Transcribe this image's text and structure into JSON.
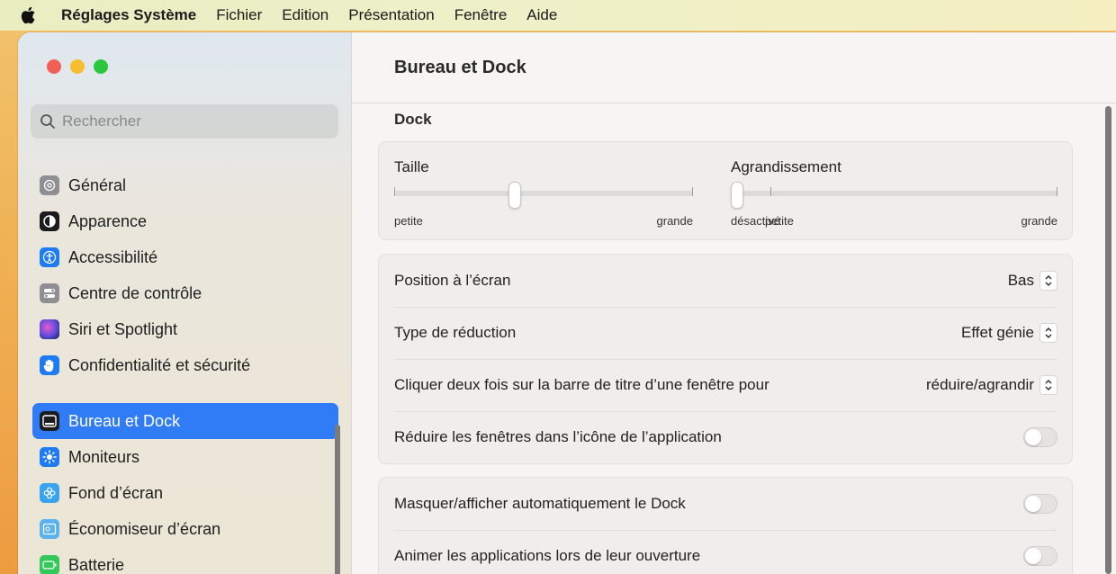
{
  "menubar": {
    "app_name": "Réglages Système",
    "items": [
      "Fichier",
      "Edition",
      "Présentation",
      "Fenêtre",
      "Aide"
    ]
  },
  "search": {
    "placeholder": "Rechercher"
  },
  "sidebar": {
    "items": [
      {
        "label": "Général",
        "icon": "gear-icon"
      },
      {
        "label": "Apparence",
        "icon": "appearance-icon"
      },
      {
        "label": "Accessibilité",
        "icon": "accessibility-icon"
      },
      {
        "label": "Centre de contrôle",
        "icon": "control-center-icon"
      },
      {
        "label": "Siri et Spotlight",
        "icon": "siri-icon"
      },
      {
        "label": "Confidentialité et sécurité",
        "icon": "privacy-hand-icon"
      },
      {
        "label": "Bureau et Dock",
        "icon": "desktop-dock-icon"
      },
      {
        "label": "Moniteurs",
        "icon": "sun-icon"
      },
      {
        "label": "Fond d’écran",
        "icon": "wallpaper-flower-icon"
      },
      {
        "label": "Économiseur d’écran",
        "icon": "screensaver-icon"
      },
      {
        "label": "Batterie",
        "icon": "battery-icon"
      }
    ],
    "selected": "Bureau et Dock"
  },
  "main": {
    "title": "Bureau et Dock",
    "section": "Dock",
    "size_slider": {
      "label": "Taille",
      "min_label": "petite",
      "max_label": "grande",
      "value": 0.4
    },
    "magnification_slider": {
      "label": "Agrandissement",
      "off_label": "désactivé",
      "min_label": "petite",
      "max_label": "grande",
      "value": 0.0
    },
    "rows": [
      {
        "label": "Position à l’écran",
        "value": "Bas"
      },
      {
        "label": "Type de réduction",
        "value": "Effet génie"
      },
      {
        "label": "Cliquer deux fois sur la barre de titre d’une fenêtre pour",
        "value": "réduire/agrandir"
      },
      {
        "label": "Réduire les fenêtres dans l’icône de l’application",
        "toggle": false
      }
    ],
    "rows2": [
      {
        "label": "Masquer/afficher automatiquement le Dock",
        "toggle": false
      },
      {
        "label": "Animer les applications lors de leur ouverture",
        "toggle": false
      }
    ]
  },
  "colors": {
    "accent": "#2f7cf6"
  }
}
